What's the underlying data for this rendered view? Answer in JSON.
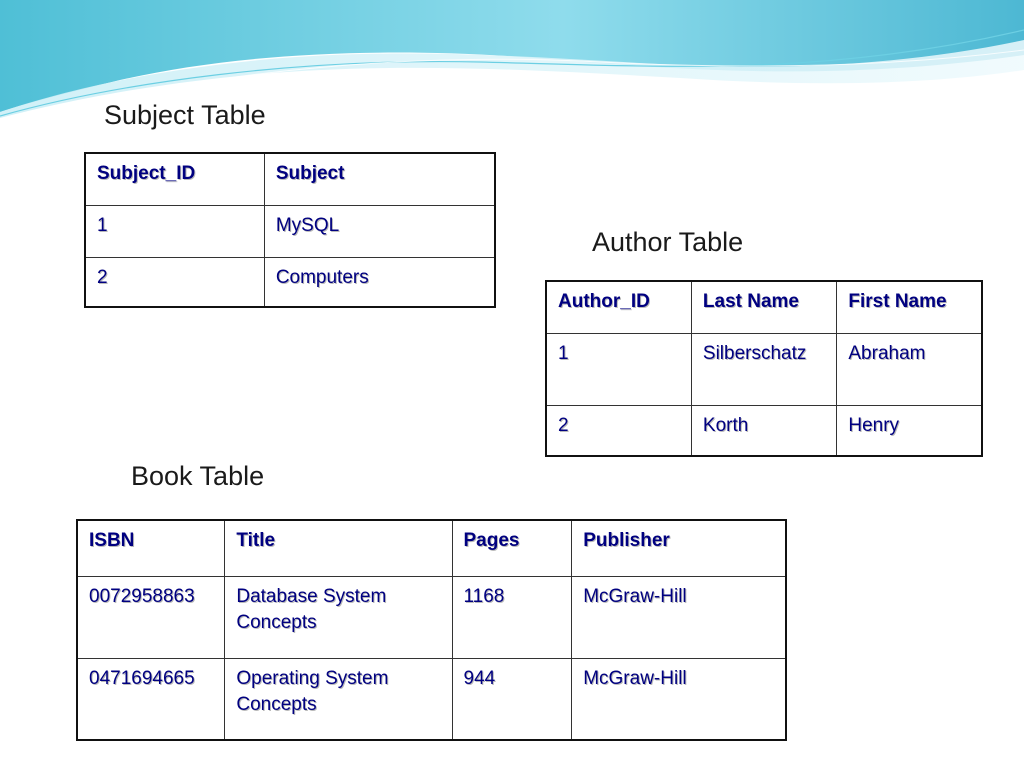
{
  "slide": {
    "subject_heading": "Subject Table",
    "author_heading": "Author Table",
    "book_heading": "Book Table"
  },
  "subject_table": {
    "headers": [
      "Subject_ID",
      "Subject"
    ],
    "rows": [
      [
        "1",
        "MySQL"
      ],
      [
        "2",
        "Computers"
      ]
    ]
  },
  "author_table": {
    "headers": [
      "Author_ID",
      "Last Name",
      "First Name"
    ],
    "rows": [
      [
        "1",
        "Silberschatz",
        "Abraham"
      ],
      [
        "2",
        "Korth",
        "Henry"
      ]
    ]
  },
  "book_table": {
    "headers": [
      "ISBN",
      "Title",
      "Pages",
      "Publisher"
    ],
    "rows": [
      [
        "0072958863",
        "Database System Concepts",
        "1168",
        "McGraw-Hill"
      ],
      [
        "0471694665",
        "Operating System Concepts",
        "944",
        "McGraw-Hill"
      ]
    ]
  },
  "theme": {
    "cell_text_color": "#000080",
    "banner_colors": [
      "#5fc6dc",
      "#a9e3ef",
      "#dff5fa"
    ]
  }
}
